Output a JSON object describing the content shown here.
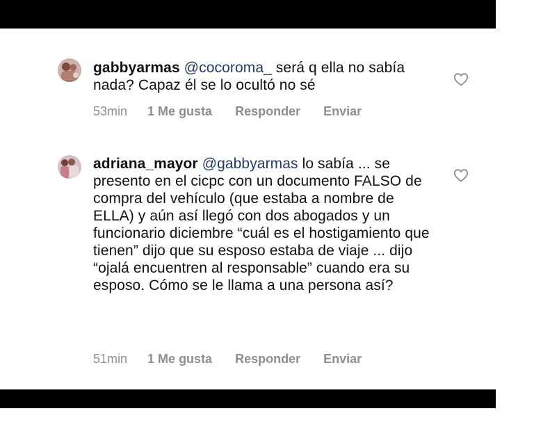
{
  "comments": [
    {
      "username": "gabbyarmas",
      "mention": "@cocoroma_",
      "text": " será q ella no sabía nada? Capaz él se lo ocultó no sé",
      "time": "53min",
      "likes": "1 Me gusta",
      "reply": "Responder",
      "send": "Enviar"
    },
    {
      "username": "adriana_mayor",
      "mention": "@gabbyarmas",
      "text": " lo sabía ... se presento en el cicpc con un documento FALSO de compra del vehículo (que estaba a nombre de ELLA) y aún así llegó con dos abogados y un funcionario diciembre “cuál es el hostigamiento que tienen” dijo que su esposo estaba de viaje ... dijo “ojalá encuentren al responsable” cuando era su esposo. Cómo se le llama a una persona así?",
      "time": "51min",
      "likes": "1 Me gusta",
      "reply": "Responder",
      "send": "Enviar"
    }
  ],
  "colors": {
    "background": "#ffffff",
    "frame": "#000000",
    "text": "#111111",
    "mention": "#1f3b6f",
    "meta": "#8e8e8e"
  },
  "icons": {
    "like": "heart-outline-icon",
    "avatar": "profile-photo"
  }
}
